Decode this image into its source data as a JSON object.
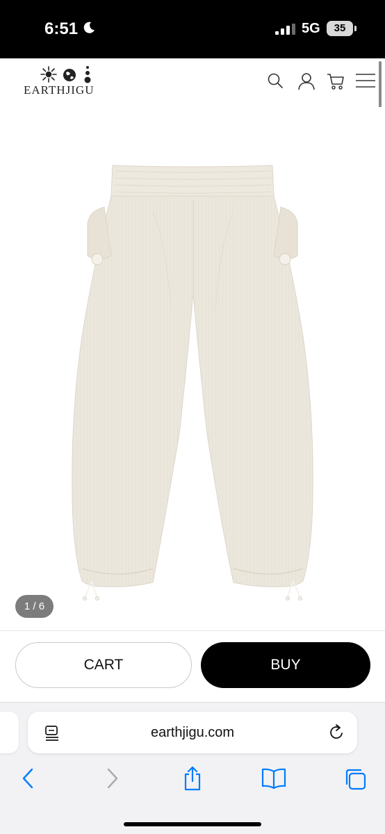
{
  "status_bar": {
    "time": "6:51",
    "network": "5G",
    "battery": "35",
    "icons": [
      "moon-icon",
      "signal-icon",
      "battery-icon"
    ]
  },
  "header": {
    "logo_text": "EARTHJIGU",
    "icons": [
      "sun-icon",
      "globe-icon",
      "search-icon",
      "user-icon",
      "cart-icon",
      "menu-icon"
    ]
  },
  "product": {
    "image": "product-pants-image",
    "slide_counter": "1 / 6"
  },
  "actions": {
    "cart_label": "CART",
    "buy_label": "BUY"
  },
  "browser": {
    "url": "earthjigu.com",
    "toolbar_icons": [
      "back-icon",
      "forward-icon",
      "share-icon",
      "bookmarks-icon",
      "tabs-icon"
    ]
  },
  "colors": {
    "accent": "#007aff",
    "buy_button": "#000000",
    "pants": "#ece7dd"
  }
}
